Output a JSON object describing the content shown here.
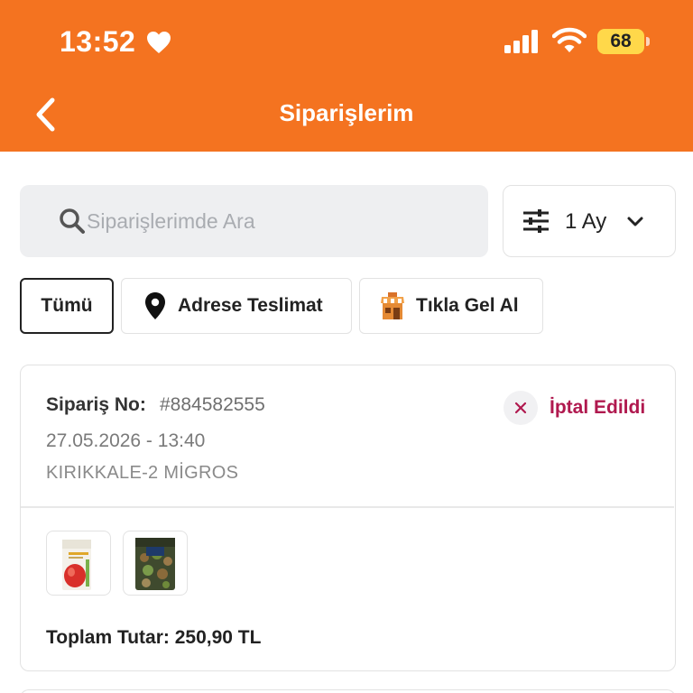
{
  "status_bar": {
    "time": "13:52",
    "battery": "68"
  },
  "header": {
    "title": "Siparişlerim"
  },
  "search": {
    "placeholder": "Siparişlerimde Ara",
    "value": ""
  },
  "period_filter": {
    "selected": "1 Ay"
  },
  "filter_chips": [
    {
      "label": "Tümü",
      "active": true
    },
    {
      "label": "Adrese Teslimat",
      "active": false
    },
    {
      "label": "Tıkla Gel Al",
      "active": false
    }
  ],
  "orders": [
    {
      "order_no_label": "Sipariş No:",
      "order_no": "#884582555",
      "date": "27.05.2026 - 13:40",
      "store": "KIRIKKALE-2 MİGROS",
      "status": "İptal Edildi",
      "total": "Toplam Tutar: 250,90 TL"
    }
  ],
  "colors": {
    "brand_orange": "#f47320",
    "status_cancelled": "#b0194f"
  },
  "icons": [
    "heart-icon",
    "signal-icon",
    "wifi-icon",
    "battery-icon",
    "back-arrow-icon",
    "search-icon",
    "filter-icon",
    "chevron-down-icon",
    "location-pin-icon",
    "store-icon",
    "close-icon"
  ]
}
